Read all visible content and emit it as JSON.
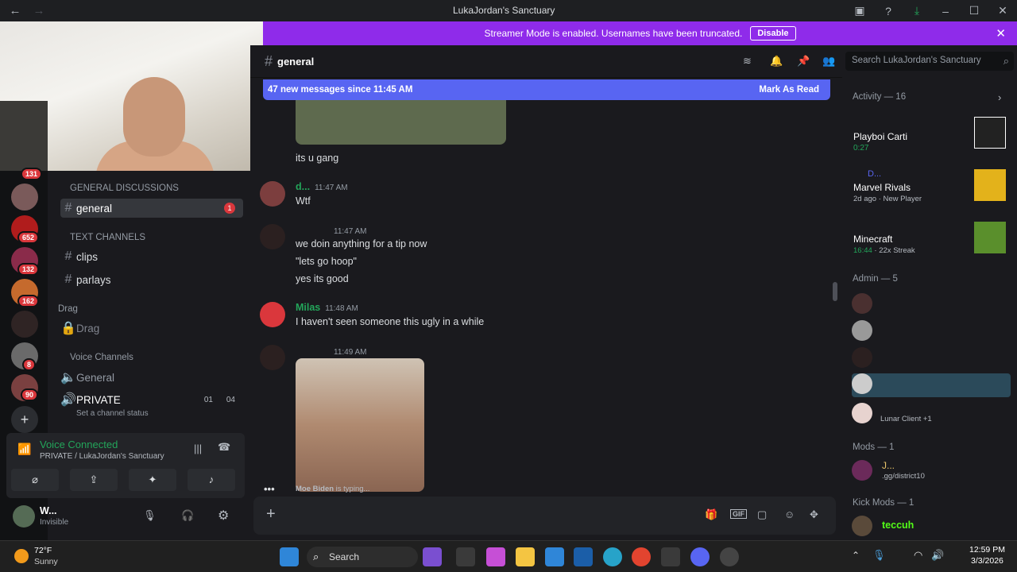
{
  "titlebar": {
    "title": "LukaJordan's Sanctuary",
    "back": "←",
    "forward": "→"
  },
  "banner": {
    "text": "Streamer Mode is enabled. Usernames have been truncated.",
    "button": "Disable"
  },
  "rail": {
    "badges": [
      "131",
      "652",
      "132",
      "162",
      "8",
      "90"
    ],
    "add": "+"
  },
  "channels": {
    "cat_general": "GENERAL DISCUSSIONS",
    "general": "general",
    "general_unread": "1",
    "cat_text": "TEXT CHANNELS",
    "clips": "clips",
    "parlays": "parlays",
    "cat_drag": "Drag",
    "drag": "Drag",
    "cat_voice": "Voice Channels",
    "voice_general": "General",
    "private": "PRIVATE",
    "private_count1": "01",
    "private_count2": "04",
    "status": "Set a channel status"
  },
  "voice": {
    "connected": "Voice Connected",
    "location": "PRIVATE / LukaJordan's Sanctuary"
  },
  "user": {
    "name": "W...",
    "status": "Invisible"
  },
  "chat": {
    "channel": "general",
    "search_placeholder": "Search LukaJordan's Sanctuary",
    "new_messages": "47 new messages since 11:45 AM",
    "mark_read": "Mark As Read",
    "messages": [
      {
        "text": "its u gang"
      },
      {
        "user": "d...",
        "time": "11:47 AM",
        "lines": [
          "Wtf"
        ]
      },
      {
        "user": "",
        "time": "11:47 AM",
        "lines": [
          "we doin anything for a tip now",
          "\"lets go hoop\"",
          "yes its good"
        ]
      },
      {
        "user": "Milas",
        "time": "11:48 AM",
        "lines": [
          "I haven't seen someone this ugly in a while"
        ]
      },
      {
        "user": "",
        "time": "11:49 AM",
        "lines": []
      }
    ],
    "typing_user": "Moe Biden",
    "typing_suffix": " is typing..."
  },
  "members": {
    "activity_header": "Activity — 16",
    "activities": [
      {
        "user": "",
        "game": "Playboi Carti",
        "detail": "0:27"
      },
      {
        "user": "D...",
        "game": "Marvel Rivals",
        "detail": "2d ago",
        "extra": "New Player"
      },
      {
        "user": "",
        "game": "Minecraft",
        "detail": "16:44",
        "extra": "22x Streak"
      }
    ],
    "admin_header": "Admin — 5",
    "admin_extra": "Lunar Client +1",
    "mods_header": "Mods — 1",
    "mod_name": "J...",
    "mod_status": ".gg/district10",
    "kick_header": "Kick Mods — 1",
    "kick_name": "teccuh"
  },
  "taskbar": {
    "temp": "72°F",
    "weather": "Sunny",
    "search": "Search",
    "time": "12:59 PM",
    "date": "3/3/2026"
  }
}
